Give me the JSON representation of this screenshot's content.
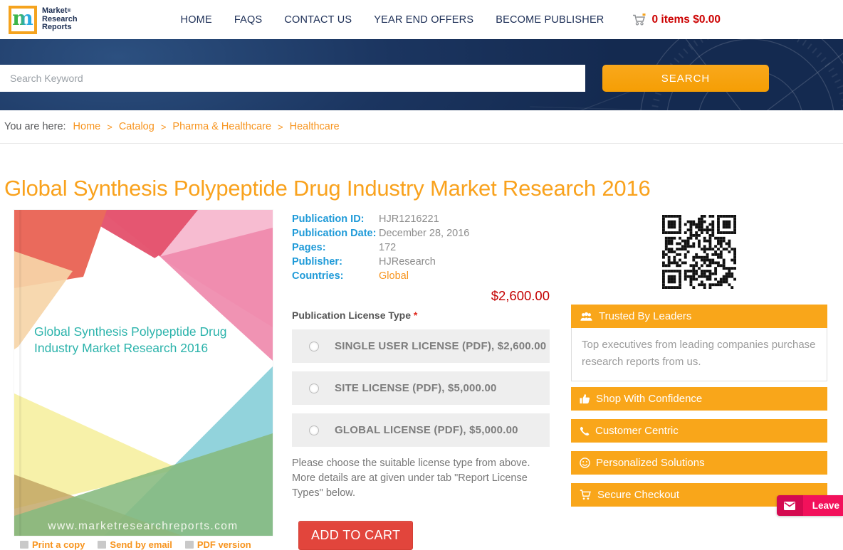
{
  "header": {
    "logo": {
      "mark": "m",
      "line1": "Market",
      "line2": "Research",
      "line3": "Reports",
      "registered": "®"
    },
    "nav": [
      {
        "label": "HOME"
      },
      {
        "label": "FAQS"
      },
      {
        "label": "CONTACT US"
      },
      {
        "label": "YEAR END OFFERS"
      },
      {
        "label": "BECOME PUBLISHER"
      }
    ],
    "cart": {
      "text": "0 items $0.00"
    }
  },
  "search": {
    "placeholder": "Search Keyword",
    "button": "SEARCH"
  },
  "breadcrumb": {
    "prefix": "You are here:",
    "sep": ">",
    "items": [
      {
        "label": "Home"
      },
      {
        "label": "Catalog"
      },
      {
        "label": "Pharma & Healthcare"
      },
      {
        "label": "Healthcare"
      }
    ]
  },
  "page": {
    "title": "Global Synthesis Polypeptide Drug Industry Market Research 2016"
  },
  "cover": {
    "title_line1": "Global Synthesis Polypeptide Drug",
    "title_line2": "Industry Market Research 2016",
    "website": "www.marketresearchreports.com",
    "links": [
      {
        "label": "Print a copy"
      },
      {
        "label": "Send by email"
      },
      {
        "label": "PDF version"
      }
    ]
  },
  "details": {
    "rows": [
      {
        "label": "Publication ID:",
        "value": "HJR1216221"
      },
      {
        "label": "Publication Date:",
        "value": "December 28, 2016"
      },
      {
        "label": "Pages:",
        "value": "172"
      },
      {
        "label": "Publisher:",
        "value": "HJResearch"
      },
      {
        "label": "Countries:",
        "value": "Global"
      }
    ],
    "price": "$2,600.00"
  },
  "license": {
    "heading": "Publication License Type",
    "required": "*",
    "options": [
      {
        "label": "SINGLE USER LICENSE (PDF), $2,600.00"
      },
      {
        "label": "SITE LICENSE (PDF), $5,000.00"
      },
      {
        "label": "GLOBAL LICENSE (PDF), $5,000.00"
      }
    ],
    "note": "Please choose the suitable license type from above. More details are at given under tab \"Report License Types\" below.",
    "add_to_cart": "ADD TO CART"
  },
  "sidebar": {
    "banners": [
      {
        "label": "Trusted By Leaders",
        "icon": "users-icon"
      },
      {
        "label": "Shop With Confidence",
        "icon": "thumbs-up-icon"
      },
      {
        "label": "Customer Centric",
        "icon": "phone-icon"
      },
      {
        "label": "Personalized Solutions",
        "icon": "smiley-icon"
      },
      {
        "label": "Secure Checkout",
        "icon": "cart-icon"
      }
    ],
    "trusted_text": "Top executives from leading companies purchase research reports from us."
  },
  "chat": {
    "label": "Leave"
  },
  "colors": {
    "accent_orange": "#f9a61a",
    "link_orange": "#f7941e",
    "label_blue": "#1e9ad8",
    "price_red": "#cc0000",
    "button_red": "#e2453c",
    "chat_pink": "#f2115b",
    "navy": "#1c2e52"
  }
}
